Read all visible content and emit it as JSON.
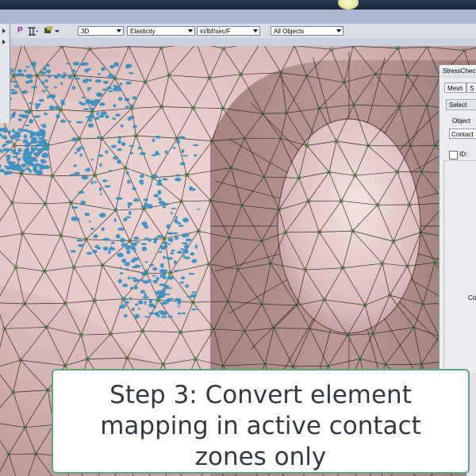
{
  "toolbar": {
    "p_label": "P",
    "combos": [
      {
        "value": "3D"
      },
      {
        "value": "Elasticity"
      },
      {
        "value": "in/lbf/sec/F"
      },
      {
        "value": "All Objects"
      }
    ]
  },
  "panel": {
    "title": "StressCheck",
    "tabs": [
      "Mesh",
      "S"
    ],
    "select_button": "Select",
    "object_label": "Object",
    "object_value": "Contact",
    "id_label": "ID:",
    "co_label": "Co"
  },
  "caption": {
    "line1": "Step 3: Convert element",
    "line2": "mapping in active contact",
    "line3": "zones only"
  },
  "colors": {
    "mesh_surface": "#cdb0ad",
    "contact_highlight": "#2f8fc4",
    "mesh_nodes": "#4f8f3a",
    "caption_border": "#57a77f"
  }
}
